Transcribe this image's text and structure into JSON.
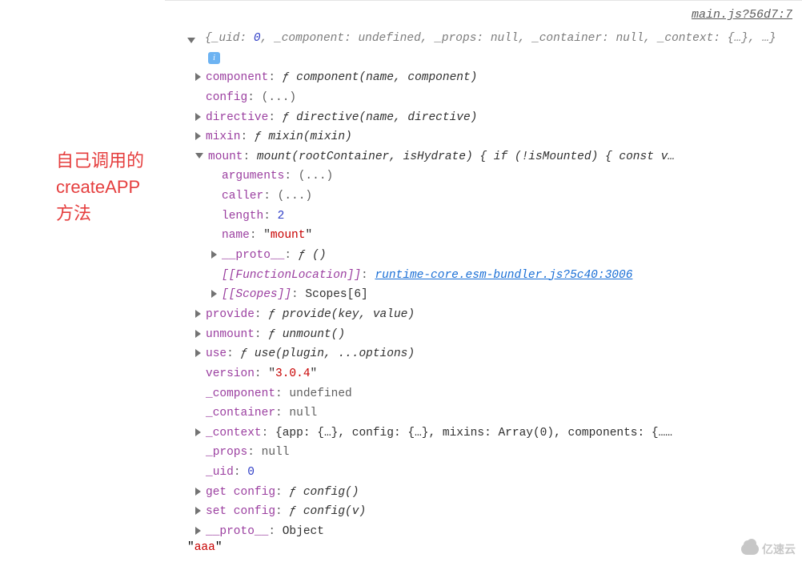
{
  "annotation": {
    "line1": "自己调用的",
    "line2": "createAPP",
    "line3": "方法"
  },
  "source_link": "main.js?56d7:7",
  "summary": {
    "text": "{_uid: 0, _component: undefined, _props: null, _container: null, _context: {…}, …}",
    "prefix": "{",
    "uid_key": "_uid",
    "uid_val": "0",
    "component_key": "_component",
    "component_val": "undefined",
    "props_key": "_props",
    "props_val": "null",
    "container_key": "_container",
    "container_val": "null",
    "context_key": "_context",
    "context_val": "{…}",
    "rest": "…}"
  },
  "info_badge": "i",
  "props": {
    "component": {
      "key": "component",
      "sig": "component(name, component)"
    },
    "config": {
      "key": "config",
      "val": "(...)"
    },
    "directive": {
      "key": "directive",
      "sig": "directive(name, directive)"
    },
    "mixin": {
      "key": "mixin",
      "sig": "mixin(mixin)"
    },
    "mount": {
      "key": "mount",
      "sig": "mount(rootContainer, isHydrate) { if (!isMounted) { const v…",
      "arguments": {
        "key": "arguments",
        "val": "(...)"
      },
      "caller": {
        "key": "caller",
        "val": "(...)"
      },
      "length": {
        "key": "length",
        "val": "2"
      },
      "name": {
        "key": "name",
        "val": "mount"
      },
      "proto": {
        "key": "__proto__",
        "sig": "()"
      },
      "funcloc": {
        "key": "[[FunctionLocation]]",
        "link": "runtime-core.esm-bundler.js?5c40:3006"
      },
      "scopes": {
        "key": "[[Scopes]]",
        "val": "Scopes[6]"
      }
    },
    "provide": {
      "key": "provide",
      "sig": "provide(key, value)"
    },
    "unmount": {
      "key": "unmount",
      "sig": "unmount()"
    },
    "use": {
      "key": "use",
      "sig": "use(plugin, ...options)"
    },
    "version": {
      "key": "version",
      "val": "3.0.4"
    },
    "_component": {
      "key": "_component",
      "val": "undefined"
    },
    "_container": {
      "key": "_container",
      "val": "null"
    },
    "_context": {
      "key": "_context",
      "val": "{app: {…}, config: {…}, mixins: Array(0), components: {……"
    },
    "_props": {
      "key": "_props",
      "val": "null"
    },
    "_uid": {
      "key": "_uid",
      "val": "0"
    },
    "get_config": {
      "key": "get config",
      "sig": "config()"
    },
    "set_config": {
      "key": "set config",
      "sig": "config(v)"
    },
    "proto": {
      "key": "__proto__",
      "val": "Object"
    }
  },
  "bottom_string": "aaa",
  "watermark": "亿速云",
  "func_f": "ƒ"
}
